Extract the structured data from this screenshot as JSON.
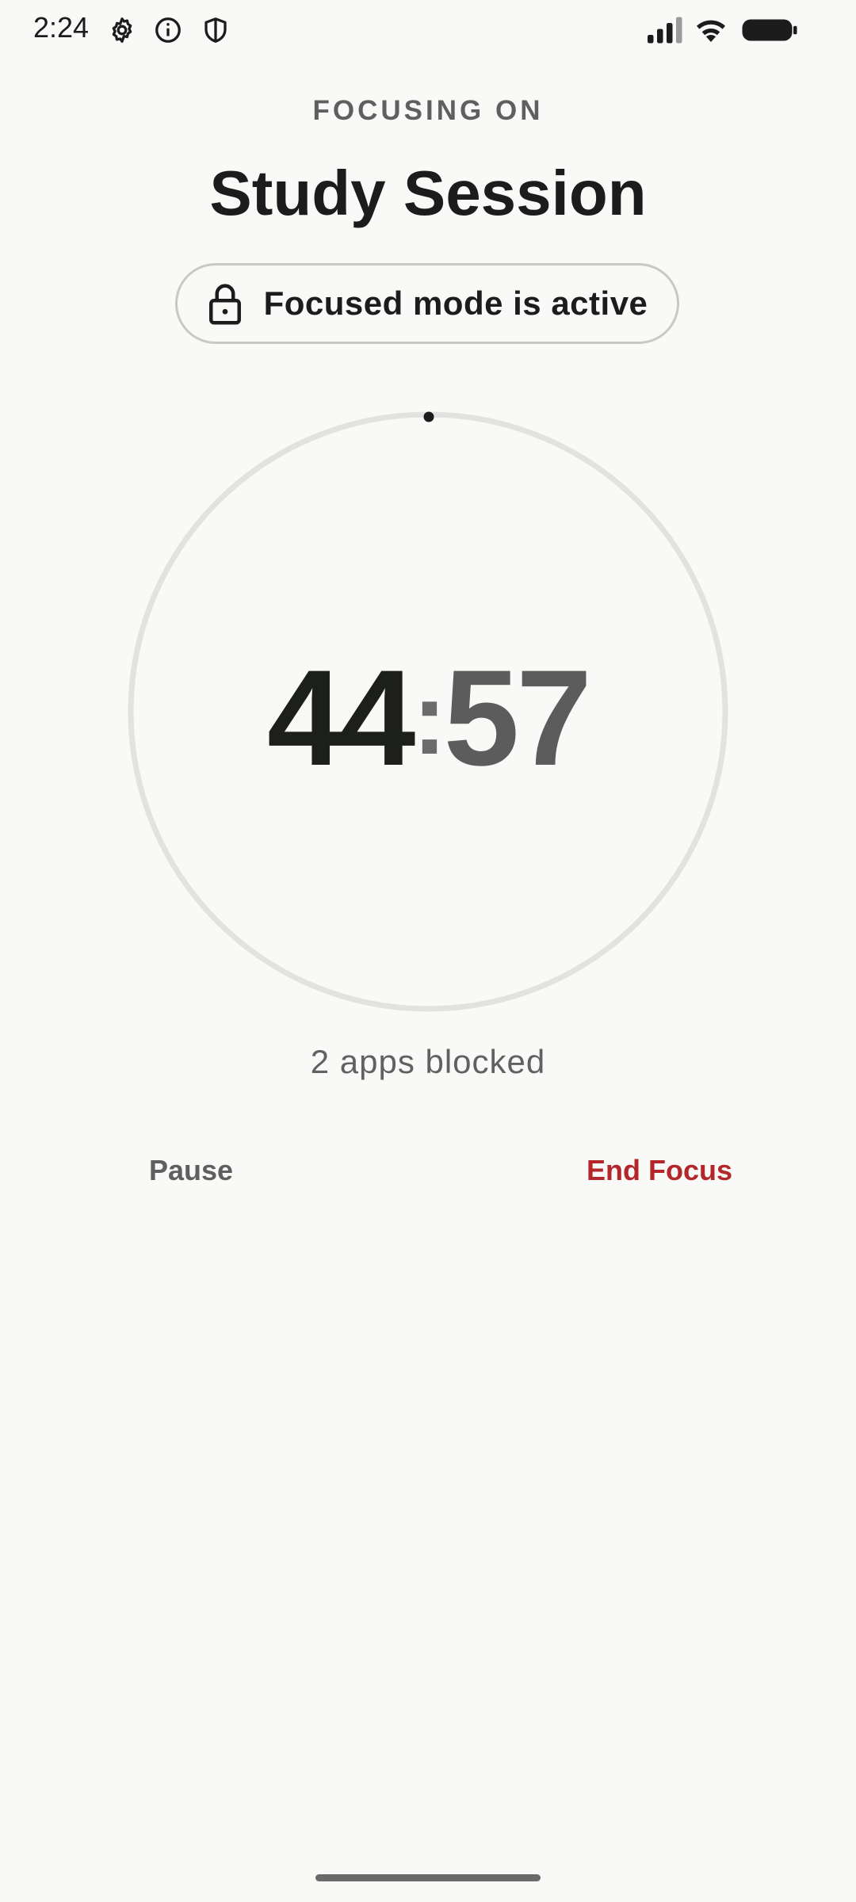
{
  "status_bar": {
    "time": "2:24",
    "left_icons": [
      "settings-gear-icon",
      "info-icon",
      "shield-icon"
    ],
    "right_icons": [
      "signal-icon",
      "wifi-icon",
      "battery-icon"
    ]
  },
  "header": {
    "label": "FOCUSING ON",
    "title": "Study Session"
  },
  "focus_badge": {
    "icon": "lock-icon",
    "text": "Focused mode is active"
  },
  "timer": {
    "minutes": "44",
    "separator": ":",
    "seconds": "57"
  },
  "blocked": {
    "text": "2 apps blocked"
  },
  "actions": {
    "pause_label": "Pause",
    "end_label": "End Focus"
  },
  "colors": {
    "background": "#f9f9f7",
    "ring_track": "#e2e3e0",
    "end_focus": "#b3262a",
    "muted_text": "#5f5f5f"
  }
}
